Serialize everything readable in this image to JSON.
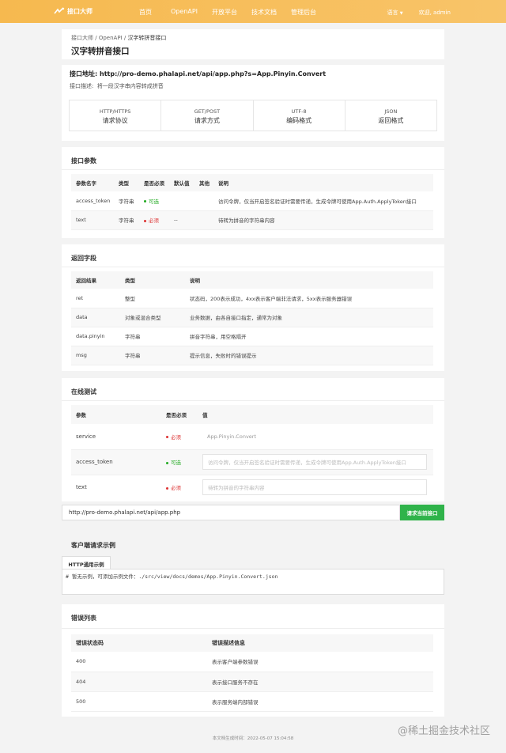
{
  "header": {
    "logo_text": "接口大师",
    "nav": [
      "首页",
      "OpenAPI",
      "开放平台",
      "技术文档",
      "管理后台"
    ],
    "language": "语言",
    "welcome": "欢迎, admin"
  },
  "breadcrumb": {
    "items": [
      "接口大师",
      "OpenAPI"
    ],
    "current": "汉字转拼音接口",
    "separator": "/"
  },
  "page_title": "汉字转拼音接口",
  "api": {
    "address_label": "接口地址:",
    "address": "http://pro-demo.phalapi.net/api/app.php?s=App.Pinyin.Convert",
    "desc_label": "接口描述:",
    "desc": "将一段汉字串内容转成拼音",
    "formats": [
      {
        "title": "HTTP/HTTPS",
        "value": "请求协议"
      },
      {
        "title": "GET/POST",
        "value": "请求方式"
      },
      {
        "title": "UTF-8",
        "value": "编码格式"
      },
      {
        "title": "JSON",
        "value": "返回格式"
      }
    ]
  },
  "params": {
    "section": "接口参数",
    "headers": [
      "参数名字",
      "类型",
      "是否必须",
      "默认值",
      "其他",
      "说明"
    ],
    "rows": [
      {
        "name": "access_token",
        "type": "字符串",
        "required": "可选",
        "default": "",
        "other": "",
        "desc": "访问令牌，仅当开启签名验证时需要传递，生成令牌可使用App.Auth.ApplyToken接口"
      },
      {
        "name": "text",
        "type": "字符串",
        "required": "必须",
        "default": "--",
        "other": "",
        "desc": "待转为拼音的字符串内容"
      }
    ]
  },
  "returns": {
    "section": "返回字段",
    "headers": [
      "返回结果",
      "类型",
      "说明"
    ],
    "rows": [
      {
        "name": "ret",
        "type": "整型",
        "desc": "状态码，200表示成功，4xx表示客户端非法请求，5xx表示服务器错误"
      },
      {
        "name": "data",
        "type": "对象或混合类型",
        "desc": "业务数据，由各自接口指定，通常为对象"
      },
      {
        "name": "data.pinyin",
        "type": "字符串",
        "desc": "拼音字符串，用空格隔开"
      },
      {
        "name": "msg",
        "type": "字符串",
        "desc": "提示信息，失败时的错误提示"
      }
    ]
  },
  "test": {
    "section": "在线测试",
    "headers": [
      "参数",
      "是否必须",
      "值"
    ],
    "rows": [
      {
        "name": "service",
        "required": "必须",
        "value": "App.Pinyin.Convert",
        "placeholder": ""
      },
      {
        "name": "access_token",
        "required": "可选",
        "value": "",
        "placeholder": "访问令牌，仅当开启签名验证时需要传递，生成令牌可使用App.Auth.ApplyToken接口"
      },
      {
        "name": "text",
        "required": "必须",
        "value": "",
        "placeholder": "待转为拼音的字符串内容"
      }
    ],
    "url": "http://pro-demo.phalapi.net/api/app.php",
    "submit": "请求当前接口"
  },
  "client": {
    "section": "客户端请求示例",
    "tab": "HTTP通用示例",
    "code": "# 暂无示例，可添加示例文件：./src/view/docs/demos/App.Pinyin.Convert.json"
  },
  "errors": {
    "section": "错误列表",
    "headers": [
      "错误状态码",
      "错误描述信息"
    ],
    "rows": [
      {
        "code": "400",
        "desc": "表示客户端参数错误"
      },
      {
        "code": "404",
        "desc": "表示接口服务不存在"
      },
      {
        "code": "500",
        "desc": "表示服务端内部错误"
      }
    ]
  },
  "footer": "本文档生成时间：2022-05-07 15:04:58",
  "watermark": "@稀土掘金技术社区",
  "colors": {
    "header": "#f6b94f",
    "required": "#d33333",
    "optional": "#22aa22",
    "button": "#2fb34a"
  }
}
